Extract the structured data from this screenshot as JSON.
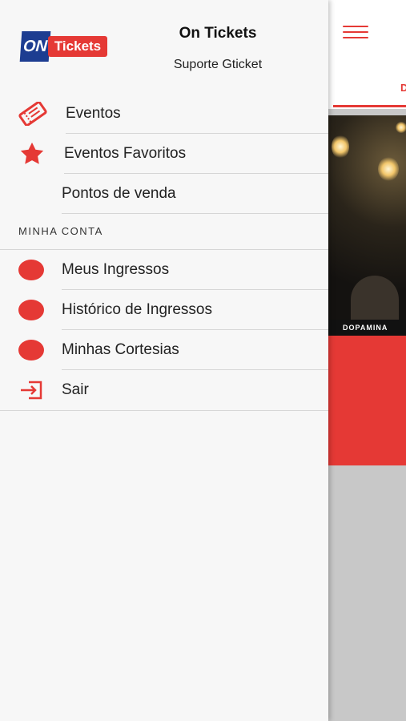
{
  "app": {
    "tab_label": "D",
    "banner_caption": "DOPAMINA",
    "colors": {
      "accent": "#e53935",
      "brand_blue": "#1d3d91"
    }
  },
  "drawer": {
    "logo": {
      "on_text": "ON",
      "tickets_text": "Tickets"
    },
    "app_name": "On Tickets",
    "support_label": "Suporte Gticket",
    "items": [
      {
        "label": "Eventos",
        "icon": "ticket-icon"
      },
      {
        "label": "Eventos Favoritos",
        "icon": "star-icon"
      },
      {
        "label": "Pontos de venda",
        "icon": ""
      }
    ],
    "section_title": "MINHA CONTA",
    "account_items": [
      {
        "label": "Meus Ingressos",
        "icon": "red-dot-icon"
      },
      {
        "label": "Histórico de Ingressos",
        "icon": "red-dot-icon"
      },
      {
        "label": "Minhas Cortesias",
        "icon": "red-dot-icon"
      },
      {
        "label": "Sair",
        "icon": "logout-icon"
      }
    ]
  }
}
